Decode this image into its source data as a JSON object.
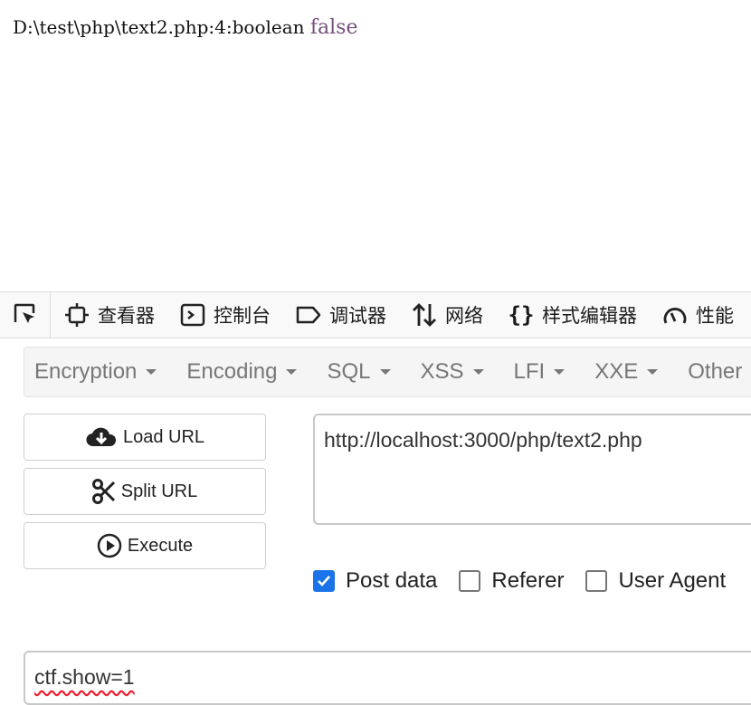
{
  "output": {
    "prefix": "D:\\test\\php\\text2.php:4:boolean",
    "value": "false"
  },
  "devtools": {
    "tabs": [
      {
        "label": "查看器",
        "icon": "inspector-icon"
      },
      {
        "label": "控制台",
        "icon": "console-icon"
      },
      {
        "label": "调试器",
        "icon": "debugger-icon"
      },
      {
        "label": "网络",
        "icon": "network-icon"
      },
      {
        "label": "样式编辑器",
        "icon": "style-editor-icon"
      },
      {
        "label": "性能",
        "icon": "performance-icon"
      }
    ]
  },
  "hackbar": {
    "menus": [
      "Encryption",
      "Encoding",
      "SQL",
      "XSS",
      "LFI",
      "XXE",
      "Other"
    ],
    "buttons": {
      "load": "Load URL",
      "split": "Split URL",
      "execute": "Execute"
    },
    "url": "http://localhost:3000/php/text2.php",
    "options": {
      "post_data": {
        "label": "Post data",
        "checked": true
      },
      "referer": {
        "label": "Referer",
        "checked": false
      },
      "user_agent": {
        "label": "User Agent",
        "checked": false
      }
    },
    "post_body": "ctf.show=1"
  },
  "colors": {
    "checkbox_accent": "#1a73e8",
    "bool_value": "#75507b"
  }
}
